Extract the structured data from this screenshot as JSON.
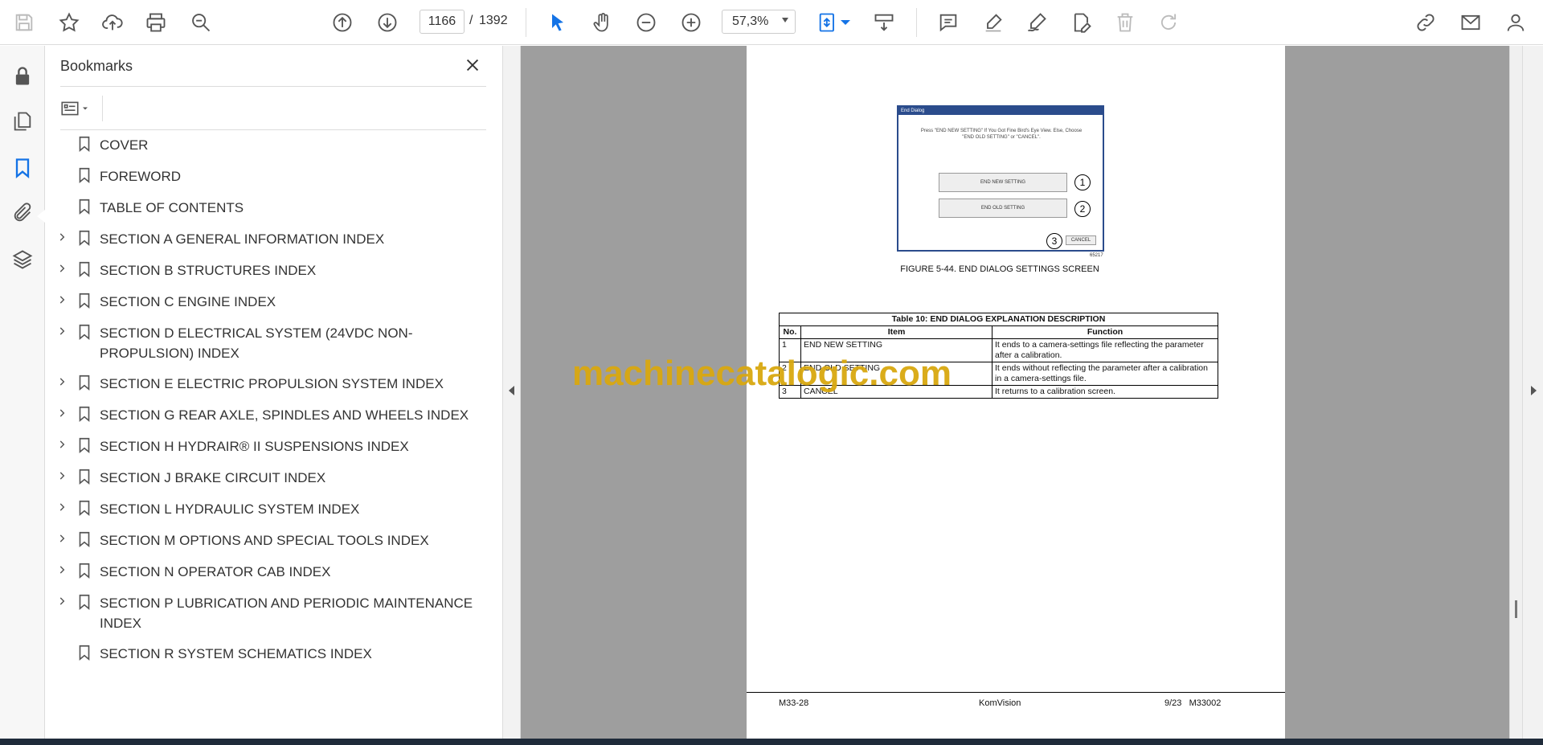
{
  "toolbar": {
    "current_page": "1166",
    "page_separator": "/",
    "total_pages": "1392",
    "zoom": "57,3%",
    "icons": [
      "save-icon",
      "star-icon",
      "upload-icon",
      "print-icon",
      "find-icon",
      "page-up-icon",
      "page-down-icon",
      "select-cursor-icon",
      "hand-icon",
      "zoom-out-icon",
      "zoom-in-icon",
      "fit-page-icon",
      "scroll-mode-icon",
      "comment-icon",
      "highlight-icon",
      "sign-icon",
      "edit-pdf-icon",
      "delete-icon",
      "rotate-icon",
      "share-link-icon",
      "mail-icon",
      "account-icon"
    ],
    "accent": "#1473e6"
  },
  "rail": {
    "icons": [
      "lock-icon",
      "pages-icon",
      "bookmark-icon",
      "attachment-icon",
      "layers-icon"
    ]
  },
  "bookmarks": {
    "title": "Bookmarks",
    "items": [
      {
        "label": "COVER",
        "expandable": false
      },
      {
        "label": "FOREWORD",
        "expandable": false
      },
      {
        "label": "TABLE OF CONTENTS",
        "expandable": false
      },
      {
        "label": "SECTION A GENERAL INFORMATION INDEX",
        "expandable": true
      },
      {
        "label": "SECTION B STRUCTURES INDEX",
        "expandable": true
      },
      {
        "label": "SECTION C ENGINE INDEX",
        "expandable": true
      },
      {
        "label": "SECTION D ELECTRICAL SYSTEM (24VDC NON-PROPULSION) INDEX",
        "expandable": true
      },
      {
        "label": "SECTION E ELECTRIC PROPULSION SYSTEM INDEX",
        "expandable": true
      },
      {
        "label": "SECTION G REAR AXLE, SPINDLES AND WHEELS INDEX",
        "expandable": true
      },
      {
        "label": "SECTION H HYDRAIR® II SUSPENSIONS INDEX",
        "expandable": true
      },
      {
        "label": "SECTION J BRAKE CIRCUIT INDEX",
        "expandable": true
      },
      {
        "label": "SECTION L HYDRAULIC SYSTEM INDEX",
        "expandable": true
      },
      {
        "label": "SECTION M OPTIONS AND SPECIAL TOOLS INDEX",
        "expandable": true
      },
      {
        "label": "SECTION N OPERATOR CAB INDEX",
        "expandable": true
      },
      {
        "label": "SECTION P LUBRICATION AND PERIODIC MAINTENANCE INDEX",
        "expandable": true
      },
      {
        "label": "SECTION R SYSTEM SCHEMATICS INDEX",
        "expandable": false
      }
    ]
  },
  "document": {
    "dialog": {
      "title": "End Dialog",
      "message": "Press \"END NEW SETTING\" If You Got Fine Bird's Eye View. Else, Choose \"END OLD SETTING\" or \"CANCEL\".",
      "btn1": "END NEW SETTING",
      "btn2": "END OLD SETTING",
      "btn3": "CANCEL",
      "callout1": "1",
      "callout2": "2",
      "callout3": "3",
      "figure_id": "65217"
    },
    "figure_caption": "FIGURE 5-44. END DIALOG SETTINGS SCREEN",
    "table": {
      "caption": "Table 10: END DIALOG EXPLANATION DESCRIPTION",
      "headers": [
        "No.",
        "Item",
        "Function"
      ],
      "rows": [
        [
          "1",
          "END NEW SETTING",
          "It ends to a camera-settings file reflecting the parameter after a calibration."
        ],
        [
          "2",
          "END OLD SETTING",
          "It ends without reflecting the parameter after a calibration in a camera-settings file."
        ],
        [
          "3",
          "CANCEL",
          "It returns to a calibration screen."
        ]
      ]
    },
    "footer": {
      "left": "M33-28",
      "center": "KomVision",
      "right": "9/23   M33002"
    },
    "watermark": "machinecatalogic.com"
  }
}
